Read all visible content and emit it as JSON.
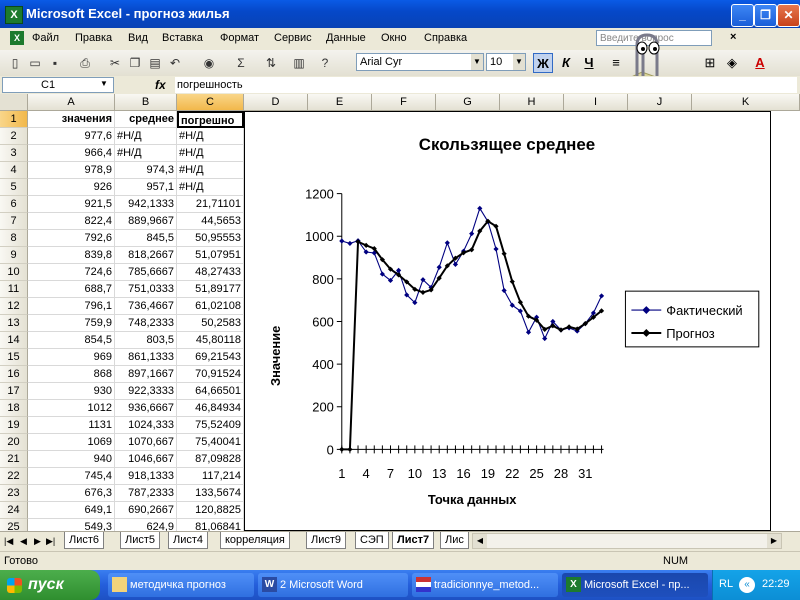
{
  "window": {
    "title": "Microsoft Excel - прогноз жилья",
    "icon": "X"
  },
  "menu": [
    "Файл",
    "Правка",
    "Вид",
    "Вставка",
    "Формат",
    "Сервис",
    "Данные",
    "Окно",
    "Справка"
  ],
  "help_placeholder": "Введите вопрос",
  "toolbar": {
    "font_name": "Arial Cyr",
    "font_size": "10",
    "bold": "Ж",
    "italic": "К",
    "underline": "Ч",
    "sigma": "Σ",
    "formula_fx": "fx"
  },
  "formula_bar": {
    "cell_ref": "C1",
    "content": "погрешность"
  },
  "columns": [
    "A",
    "B",
    "C",
    "D",
    "E",
    "F",
    "G",
    "H",
    "I",
    "J",
    "K"
  ],
  "rows": [
    {
      "n": "1",
      "a": "значения",
      "b": "среднее",
      "c": "погрешно"
    },
    {
      "n": "2",
      "a": "977,6",
      "b": "#Н/Д",
      "c": "#Н/Д"
    },
    {
      "n": "3",
      "a": "966,4",
      "b": "#Н/Д",
      "c": "#Н/Д"
    },
    {
      "n": "4",
      "a": "978,9",
      "b": "974,3",
      "c": "#Н/Д"
    },
    {
      "n": "5",
      "a": "926",
      "b": "957,1",
      "c": "#Н/Д"
    },
    {
      "n": "6",
      "a": "921,5",
      "b": "942,1333",
      "c": "21,71101"
    },
    {
      "n": "7",
      "a": "822,4",
      "b": "889,9667",
      "c": "44,5653"
    },
    {
      "n": "8",
      "a": "792,6",
      "b": "845,5",
      "c": "50,95553"
    },
    {
      "n": "9",
      "a": "839,8",
      "b": "818,2667",
      "c": "51,07951"
    },
    {
      "n": "10",
      "a": "724,6",
      "b": "785,6667",
      "c": "48,27433"
    },
    {
      "n": "11",
      "a": "688,7",
      "b": "751,0333",
      "c": "51,89177"
    },
    {
      "n": "12",
      "a": "796,1",
      "b": "736,4667",
      "c": "61,02108"
    },
    {
      "n": "13",
      "a": "759,9",
      "b": "748,2333",
      "c": "50,2583"
    },
    {
      "n": "14",
      "a": "854,5",
      "b": "803,5",
      "c": "45,80118"
    },
    {
      "n": "15",
      "a": "969",
      "b": "861,1333",
      "c": "69,21543"
    },
    {
      "n": "16",
      "a": "868",
      "b": "897,1667",
      "c": "70,91524"
    },
    {
      "n": "17",
      "a": "930",
      "b": "922,3333",
      "c": "64,66501"
    },
    {
      "n": "18",
      "a": "1012",
      "b": "936,6667",
      "c": "46,84934"
    },
    {
      "n": "19",
      "a": "1131",
      "b": "1024,333",
      "c": "75,52409"
    },
    {
      "n": "20",
      "a": "1069",
      "b": "1070,667",
      "c": "75,40041"
    },
    {
      "n": "21",
      "a": "940",
      "b": "1046,667",
      "c": "87,09828"
    },
    {
      "n": "22",
      "a": "745,4",
      "b": "918,1333",
      "c": "117,214"
    },
    {
      "n": "23",
      "a": "676,3",
      "b": "787,2333",
      "c": "133,5674"
    },
    {
      "n": "24",
      "a": "649,1",
      "b": "690,2667",
      "c": "120,8825"
    },
    {
      "n": "25",
      "a": "549,3",
      "b": "624,9",
      "c": "81,06841"
    }
  ],
  "sheet_tabs": [
    "Лист6",
    "Лист5",
    "Лист4",
    "корреляция",
    "Лист9",
    "СЭП",
    "Лист7",
    "Лис"
  ],
  "active_tab": "Лист7",
  "status": {
    "left": "Готово",
    "num": "NUM"
  },
  "taskbar": {
    "start": "пуск",
    "tasks": [
      "методичка прогноз",
      "2 Microsoft Word",
      "tradicionnye_metod...",
      "Microsoft Excel - пр..."
    ],
    "lang": "RL",
    "time": "22:29"
  },
  "chart_data": {
    "type": "line",
    "title": "Скользящее среднее",
    "xlabel": "Точка данных",
    "ylabel": "Значение",
    "ylim": [
      0,
      1200
    ],
    "yticks": [
      0,
      200,
      400,
      600,
      800,
      1000,
      1200
    ],
    "xtick_labels": [
      "1",
      "4",
      "7",
      "10",
      "13",
      "16",
      "19",
      "22",
      "25",
      "28",
      "31"
    ],
    "x": [
      1,
      2,
      3,
      4,
      5,
      6,
      7,
      8,
      9,
      10,
      11,
      12,
      13,
      14,
      15,
      16,
      17,
      18,
      19,
      20,
      21,
      22,
      23,
      24,
      25,
      26,
      27,
      28,
      29,
      30,
      31,
      32,
      33
    ],
    "legend": "right",
    "series": [
      {
        "name": "Фактический",
        "color": "#000080",
        "marker": "diamond",
        "values": [
          977.6,
          966.4,
          978.9,
          926,
          921.5,
          822.4,
          792.6,
          839.8,
          724.6,
          688.7,
          796.1,
          759.9,
          854.5,
          969,
          868,
          930,
          1012,
          1131,
          1069,
          940,
          745.4,
          676.3,
          649.1,
          549.3,
          620,
          520,
          600,
          560,
          570,
          555,
          590,
          640,
          720
        ]
      },
      {
        "name": "Прогноз",
        "color": "#000000",
        "marker": "diamond",
        "values": [
          0,
          0,
          974.3,
          957.1,
          942.1,
          890,
          845.5,
          818.3,
          785.7,
          751,
          736.5,
          748.2,
          803.5,
          861.1,
          897.2,
          922.3,
          936.7,
          1024.3,
          1070.7,
          1046.7,
          918.1,
          787.2,
          690.3,
          624.9,
          606,
          563,
          580,
          560,
          575,
          565,
          590,
          620,
          650
        ]
      }
    ]
  }
}
